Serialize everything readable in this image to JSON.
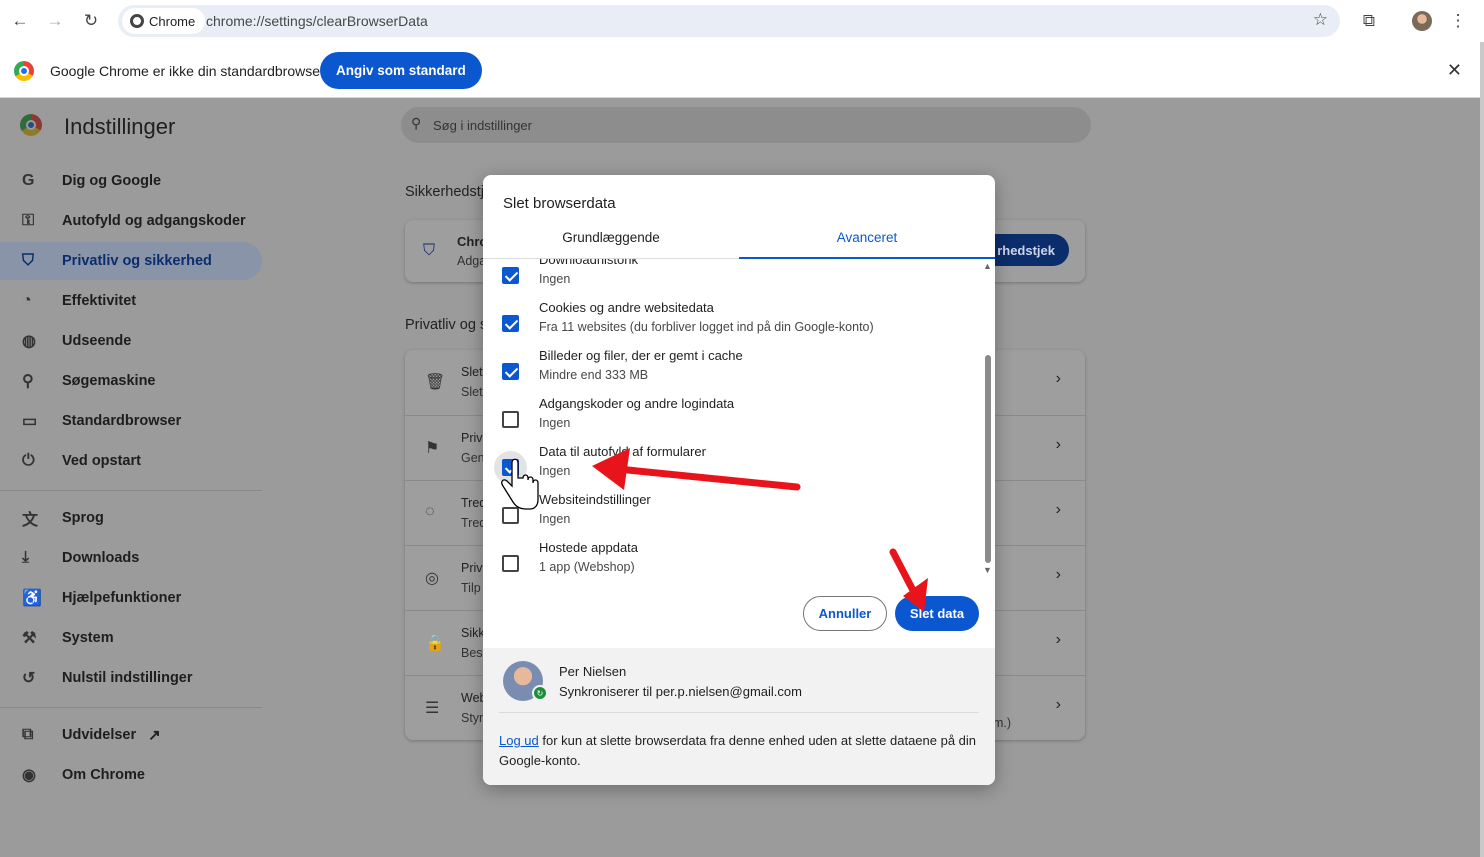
{
  "toolbar": {
    "chip_label": "Chrome",
    "url": "chrome://settings/clearBrowserData"
  },
  "infobar": {
    "text": "Google Chrome er ikke din standardbrowser",
    "button": "Angiv som standard"
  },
  "settings": {
    "title": "Indstillinger",
    "search_placeholder": "Søg i indstillinger"
  },
  "sidebar": {
    "items": [
      {
        "label": "Dig og Google",
        "icon": "google-g-icon"
      },
      {
        "label": "Autofyld og adgangskoder",
        "icon": "key-icon"
      },
      {
        "label": "Privatliv og sikkerhed",
        "icon": "shield-icon"
      },
      {
        "label": "Effektivitet",
        "icon": "speedometer-icon"
      },
      {
        "label": "Udseende",
        "icon": "palette-icon"
      },
      {
        "label": "Søgemaskine",
        "icon": "search-icon"
      },
      {
        "label": "Standardbrowser",
        "icon": "browser-window-icon"
      },
      {
        "label": "Ved opstart",
        "icon": "power-icon"
      },
      {
        "label": "Sprog",
        "icon": "translate-icon"
      },
      {
        "label": "Downloads",
        "icon": "download-icon"
      },
      {
        "label": "Hjælpefunktioner",
        "icon": "accessibility-icon"
      },
      {
        "label": "System",
        "icon": "wrench-icon"
      },
      {
        "label": "Nulstil indstillinger",
        "icon": "reset-icon"
      },
      {
        "label": "Udvidelser",
        "icon": "puzzle-icon"
      },
      {
        "label": "Om Chrome",
        "icon": "chrome-icon"
      }
    ]
  },
  "main": {
    "safety_heading": "Sikkerhedstj",
    "safety_card_title": "Chro",
    "safety_card_sub": "Adga",
    "safety_button": "rhedstjek",
    "privacy_heading": "Privatliv og s",
    "rows": [
      {
        "t1": "Slet",
        "t2": "Slet"
      },
      {
        "t1": "Priv",
        "t2": "Gen"
      },
      {
        "t1": "Tred",
        "t2": "Tred"
      },
      {
        "t1": "Priv",
        "t2": "Tilp"
      },
      {
        "t1": "Sikk",
        "t2": "Besk"
      },
      {
        "t1": "Web",
        "t2": "Styr",
        "tail": "m.)"
      }
    ]
  },
  "dialog": {
    "title": "Slet browserdata",
    "tabs": [
      "Grundlæggende",
      "Avanceret"
    ],
    "items": [
      {
        "label": "Downloadhistorik",
        "sub": "Ingen",
        "checked": true
      },
      {
        "label": "Cookies og andre websitedata",
        "sub": "Fra 11 websites (du forbliver logget ind på din Google-konto)",
        "checked": true
      },
      {
        "label": "Billeder og filer, der er gemt i cache",
        "sub": "Mindre end 333 MB",
        "checked": true
      },
      {
        "label": "Adgangskoder og andre logindata",
        "sub": "Ingen",
        "checked": false
      },
      {
        "label": "Data til autofyld af formularer",
        "sub": "Ingen",
        "checked": true
      },
      {
        "label": "Websiteindstillinger",
        "sub": "Ingen",
        "checked": false
      },
      {
        "label": "Hostede appdata",
        "sub": "1 app (Webshop)",
        "checked": false
      }
    ],
    "cancel": "Annuller",
    "delete": "Slet data",
    "user_name": "Per Nielsen",
    "user_sync": "Synkroniserer til per.p.nielsen@gmail.com",
    "logout_link": "Log ud",
    "logout_note": " for kun at slette browserdata fra denne enhed uden at slette dataene på din Google-konto."
  },
  "colors": {
    "accent": "#0b57d0",
    "annotation": "#e8141b"
  }
}
